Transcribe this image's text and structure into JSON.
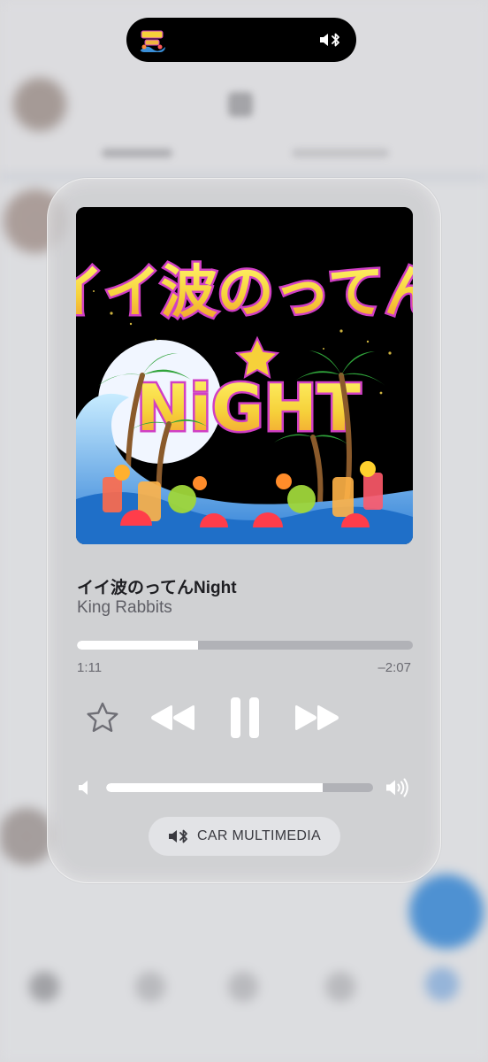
{
  "now_playing": {
    "title": "イイ波のってんNight",
    "artist": "King Rabbits",
    "artwork_text": {
      "line1": "イイ波のってん",
      "line2": "NiGHT"
    },
    "progress_fraction": 0.36,
    "elapsed": "1:11",
    "remaining": "–2:07"
  },
  "controls": {
    "favorite_icon": "star-outline-icon",
    "previous_icon": "backward-icon",
    "play_pause_icon": "pause-icon",
    "next_icon": "forward-icon"
  },
  "volume": {
    "level_fraction": 0.81,
    "low_icon": "speaker-low-icon",
    "high_icon": "speaker-high-icon"
  },
  "route": {
    "label": "CAR MULTIMEDIA",
    "icon": "speaker-bluetooth-icon"
  },
  "island": {
    "art_icon": "album-thumbnail",
    "route_icon": "speaker-bluetooth-icon"
  },
  "colors": {
    "title": "#1e1e22",
    "artist": "#5f5f66",
    "control": "#ffffff",
    "star": "#6e6e75",
    "artwork_text_fill": "#f6d13a",
    "artwork_text_stroke": "#d03fc4"
  }
}
